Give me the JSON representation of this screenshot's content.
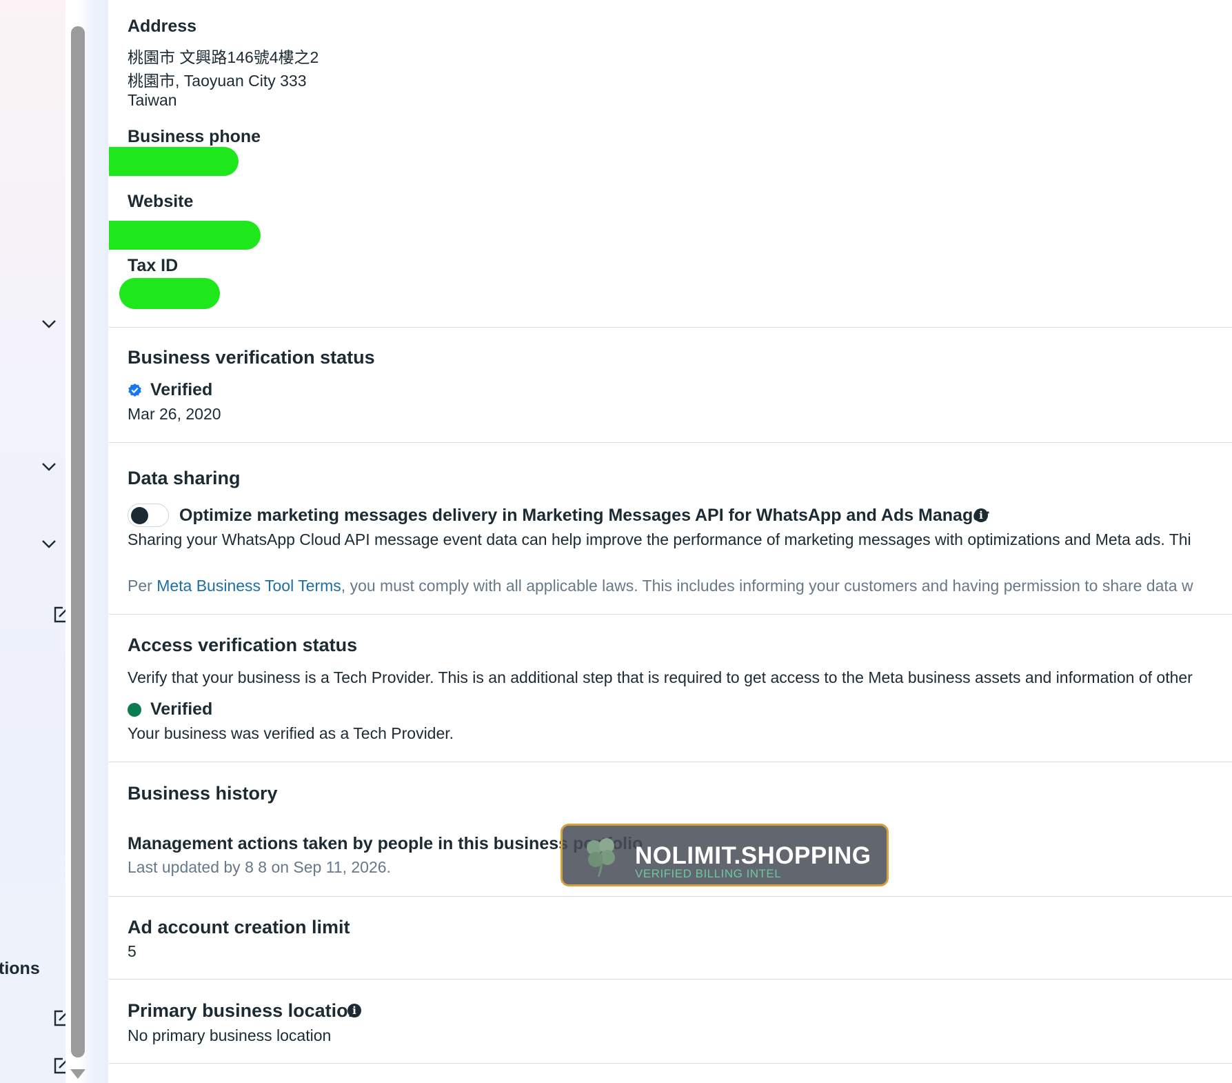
{
  "sidebar": {
    "truncated_label": "tions",
    "collapse_icon": "chevron-down-icon",
    "external_icon": "external-link-icon"
  },
  "details": {
    "address_label": "Address",
    "address_line1": "桃園市 文興路146號4樓之2",
    "address_line2": "桃園市, Taoyuan City 333",
    "address_line3": "Taiwan",
    "phone_label": "Business phone",
    "website_label": "Website",
    "tax_label": "Tax ID",
    "redaction_color": "#1ee81c"
  },
  "business_verification": {
    "title": "Business verification status",
    "status": "Verified",
    "date": "Mar 26, 2020",
    "badge_color": "#1877f2"
  },
  "data_sharing": {
    "title": "Data sharing",
    "toggle_label": "Optimize marketing messages delivery in Marketing Messages API for WhatsApp and Ads Manager",
    "toggle_on": false,
    "description": "Sharing your WhatsApp Cloud API message event data can help improve the performance of marketing messages with optimizations and Meta ads. Thi",
    "terms_prefix": "Per ",
    "terms_link": "Meta Business Tool Terms",
    "terms_suffix": ", you must comply with all applicable laws. This includes informing your customers and having permission to share data w"
  },
  "access_verification": {
    "title": "Access verification status",
    "description": "Verify that your business is a Tech Provider. This is an additional step that is required to get access to the Meta business assets and information of other",
    "status": "Verified",
    "status_detail": "Your business was verified as a Tech Provider.",
    "status_color": "#0a7c50"
  },
  "business_history": {
    "title": "Business history",
    "item_title": "Management actions taken by people in this business portfolio",
    "item_meta": "Last updated by 8 8 on Sep 11, 2026."
  },
  "ad_account_limit": {
    "title": "Ad account creation limit",
    "value": "5"
  },
  "primary_location": {
    "title": "Primary business location",
    "value": "No primary business location"
  },
  "watermark": {
    "name": "NOLIMIT.SHOPPING",
    "tagline": "VERIFIED BILLING INTEL",
    "icon": "clover-icon",
    "border_color": "#d9a13a"
  }
}
